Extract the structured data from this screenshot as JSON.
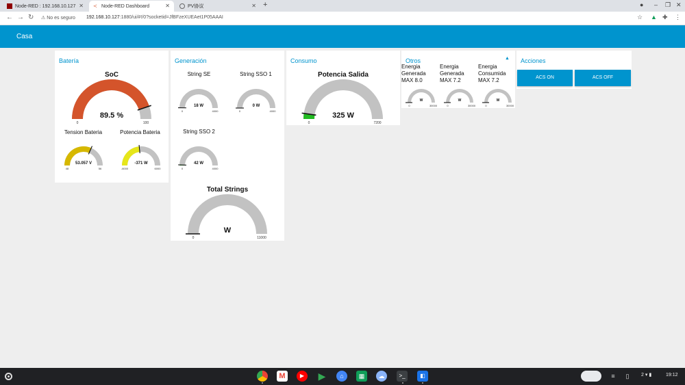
{
  "browser": {
    "tabs": [
      {
        "title": "Node-RED : 192.168.10.127"
      },
      {
        "title": "Node-RED Dashboard"
      },
      {
        "title": "PV协议"
      }
    ],
    "security_label": "No es seguro",
    "url_host": "192.168.10.127",
    "url_rest": ":1880/ui/#!/0?socketid=JfBFzeXUEAet1P05AAAI"
  },
  "header": {
    "title": "Casa"
  },
  "groups": {
    "bateria": {
      "title": "Batería"
    },
    "generacion": {
      "title": "Generación"
    },
    "consumo": {
      "title": "Consumo"
    },
    "otros": {
      "title": "Otros"
    },
    "acciones": {
      "title": "Acciones"
    }
  },
  "gauges": {
    "soc": {
      "title": "SoC",
      "value_text": "89.5 %",
      "value": 89.5,
      "min": 0,
      "max": 100,
      "min_label": "0",
      "max_label": "100",
      "color": "#d4542b"
    },
    "tension": {
      "title": "Tension Bateria",
      "value_text": "53.057 V",
      "value": 53.057,
      "min": 48,
      "max": 56,
      "min_label": "48",
      "max_label": "56",
      "color": "#d6b800"
    },
    "potencia_bat": {
      "title": "Potencia Bateria",
      "value_text": "-371 W",
      "value": -371,
      "min": -6000,
      "max": 6000,
      "min_label": "-6000",
      "max_label": "6000",
      "color": "#e6e61a"
    },
    "string_se": {
      "title": "String SE",
      "value_text": "18 W",
      "value": 18,
      "min": 0,
      "max": 4000,
      "min_label": "0",
      "max_label": "4000",
      "color": "#2ca02c"
    },
    "string_sso1": {
      "title": "String SSO 1",
      "value_text": "0 W",
      "value": 0,
      "min": 0,
      "max": 4000,
      "min_label": "0",
      "max_label": "4000",
      "color": "#2ca02c"
    },
    "string_sso2": {
      "title": "String SSO 2",
      "value_text": "42 W",
      "value": 42,
      "min": 0,
      "max": 4000,
      "min_label": "0",
      "max_label": "4000",
      "color": "#2ca02c"
    },
    "total_strings": {
      "title": "Total Strings",
      "value_text": "W",
      "value": 0,
      "min": 0,
      "max": 11000,
      "min_label": "0",
      "max_label": "11000",
      "color": "#2ca02c"
    },
    "potencia_salida": {
      "title": "Potencia Salida",
      "value_text": "325 W",
      "value": 325,
      "min": 0,
      "max": 7200,
      "min_label": "0",
      "max_label": "7200",
      "color": "#22bb22"
    },
    "energia_gen1": {
      "title": "Energia Generada MAX 8.0",
      "value_text": "W",
      "value": 0,
      "min": 0,
      "max": 30000,
      "min_label": "0",
      "max_label": "30000",
      "color": "#2ca02c"
    },
    "energia_gen2": {
      "title": "Energia Generada MAX 7.2",
      "value_text": "W",
      "value": 0,
      "min": 0,
      "max": 30000,
      "min_label": "0",
      "max_label": "30000",
      "color": "#2ca02c"
    },
    "energia_cons": {
      "title": "Energia Consumida MAX 7.2",
      "value_text": "W",
      "value": 0,
      "min": 0,
      "max": 30000,
      "min_label": "0",
      "max_label": "30000",
      "color": "#2ca02c"
    }
  },
  "actions": {
    "acs_on": "ACS ON",
    "acs_off": "ACS OFF"
  },
  "taskbar": {
    "time": "19:12",
    "notifications": "2"
  }
}
